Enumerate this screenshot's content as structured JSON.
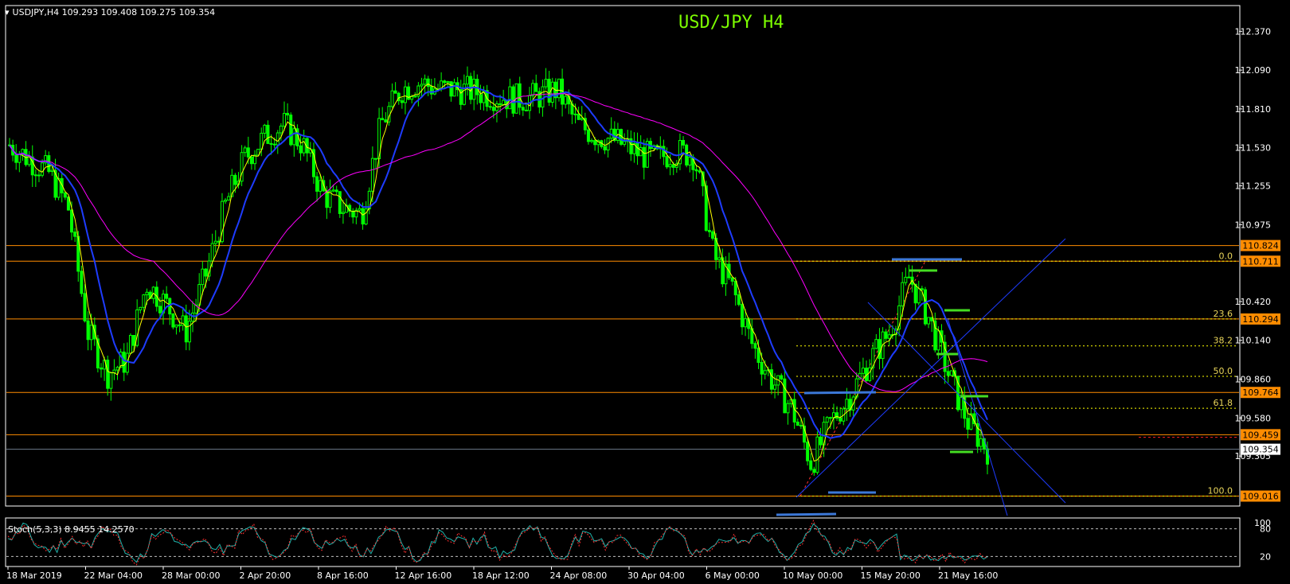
{
  "header": {
    "symbol_line": "USDJPY,H4  109.293 109.408 109.275 109.354",
    "title": "USD/JPY  H4"
  },
  "indicator": {
    "label": "Stoch(5,3,3) 8.9455 14.2570",
    "scale_top": "100",
    "level_high": "80",
    "level_low": "20"
  },
  "chart_data": {
    "type": "candlestick",
    "symbol": "USDJPY",
    "timeframe": "H4",
    "price_ticks": [
      "112.370",
      "112.090",
      "111.810",
      "111.530",
      "111.255",
      "110.975",
      "110.420",
      "110.140",
      "109.860",
      "109.580",
      "109.305"
    ],
    "price_tick_values": [
      112.37,
      112.09,
      111.81,
      111.53,
      111.255,
      110.975,
      110.42,
      110.14,
      109.86,
      109.58,
      109.305
    ],
    "ylim": [
      108.95,
      112.55
    ],
    "date_ticks": [
      "18 Mar 2019",
      "22 Mar 04:00",
      "28 Mar 00:00",
      "2 Apr 20:00",
      "8 Apr 16:00",
      "12 Apr 16:00",
      "18 Apr 12:00",
      "24 Apr 08:00",
      "30 Apr 04:00",
      "6 May 00:00",
      "10 May 00:00",
      "15 May 20:00",
      "21 May 16:00"
    ],
    "horizontal_levels": [
      {
        "value": 110.824,
        "label": "110.824",
        "color": "#FF8C00"
      },
      {
        "value": 110.711,
        "label": "110.711",
        "color": "#FF8C00"
      },
      {
        "value": 110.294,
        "label": "110.294",
        "color": "#FF8C00"
      },
      {
        "value": 109.764,
        "label": "109.764",
        "color": "#FF8C00"
      },
      {
        "value": 109.459,
        "label": "109.459",
        "color": "#FF8C00"
      },
      {
        "value": 109.016,
        "label": "109.016",
        "color": "#FF8C00"
      }
    ],
    "current_price": {
      "value": 109.354,
      "label": "109.354"
    },
    "fibonacci": [
      {
        "level": "0.0",
        "value": 110.711
      },
      {
        "level": "23.6",
        "value": 110.294
      },
      {
        "level": "38.2",
        "value": 110.1
      },
      {
        "level": "50.0",
        "value": 109.88
      },
      {
        "level": "61.8",
        "value": 109.65
      },
      {
        "level": "100.0",
        "value": 109.016
      }
    ],
    "close_path": [
      [
        "18 Mar 2019",
        111.55
      ],
      [
        "19 Mar",
        111.45
      ],
      [
        "20 Mar",
        111.35
      ],
      [
        "21 Mar",
        111.1
      ],
      [
        "22 Mar 04:00",
        110.2
      ],
      [
        "23 Mar",
        109.9
      ],
      [
        "25 Mar",
        110.0
      ],
      [
        "26 Mar",
        110.55
      ],
      [
        "27 Mar",
        110.4
      ],
      [
        "28 Mar 00:00",
        110.2
      ],
      [
        "29 Mar",
        110.6
      ],
      [
        "1 Apr",
        111.1
      ],
      [
        "2 Apr 20:00",
        111.45
      ],
      [
        "3 Apr",
        111.6
      ],
      [
        "4 Apr",
        111.7
      ],
      [
        "5 Apr",
        111.55
      ],
      [
        "8 Apr 16:00",
        111.2
      ],
      [
        "9 Apr",
        111.1
      ],
      [
        "10 Apr",
        111.05
      ],
      [
        "11 Apr",
        111.7
      ],
      [
        "12 Apr 16:00",
        111.95
      ],
      [
        "15 Apr",
        112.0
      ],
      [
        "16 Apr",
        111.95
      ],
      [
        "17 Apr",
        111.95
      ],
      [
        "18 Apr 12:00",
        111.93
      ],
      [
        "19 Apr",
        111.9
      ],
      [
        "22 Apr",
        111.88
      ],
      [
        "23 Apr",
        111.9
      ],
      [
        "24 Apr 08:00",
        111.95
      ],
      [
        "25 Apr",
        111.7
      ],
      [
        "26 Apr",
        111.62
      ],
      [
        "29 Apr",
        111.58
      ],
      [
        "30 Apr 04:00",
        111.5
      ],
      [
        "1 May",
        111.45
      ],
      [
        "2 May",
        111.5
      ],
      [
        "3 May",
        111.48
      ],
      [
        "6 May 00:00",
        110.75
      ],
      [
        "7 May",
        110.5
      ],
      [
        "8 May",
        110.1
      ],
      [
        "9 May",
        109.85
      ],
      [
        "10 May 00:00",
        109.65
      ],
      [
        "13 May",
        109.25
      ],
      [
        "14 May",
        109.55
      ],
      [
        "15 May 20:00",
        109.75
      ],
      [
        "16 May",
        110.0
      ],
      [
        "17 May",
        110.2
      ],
      [
        "20 May",
        110.6
      ],
      [
        "21 May",
        110.3
      ],
      [
        "21 May 16:00",
        109.9
      ],
      [
        "22 May",
        109.55
      ],
      [
        "23 May",
        109.354
      ]
    ],
    "moving_averages": [
      {
        "name": "fast",
        "color": "#FFFF00"
      },
      {
        "name": "mid",
        "color": "#1E3CFF"
      },
      {
        "name": "slow",
        "color": "#FF00FF"
      }
    ],
    "grid": false,
    "candle_color": "#00FF00",
    "background": "#000000"
  }
}
